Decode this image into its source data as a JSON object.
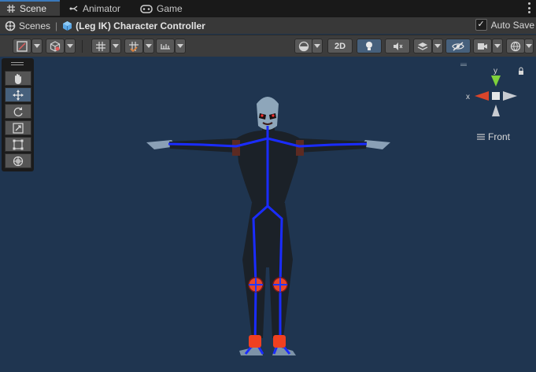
{
  "tabs": [
    {
      "label": "Scene",
      "icon": "grid-icon",
      "active": true
    },
    {
      "label": "Animator",
      "icon": "animator-icon",
      "active": false
    },
    {
      "label": "Game",
      "icon": "gamepad-icon",
      "active": false
    }
  ],
  "breadcrumb": {
    "root": "Scenes",
    "current": "(Leg IK) Character Controller"
  },
  "autosave": {
    "label": "Auto Save",
    "checked": true
  },
  "toolbar": {
    "mode_2d_label": "2D"
  },
  "tools": [
    "hand-tool",
    "move-tool",
    "rotate-tool",
    "scale-tool",
    "rect-tool",
    "transform-tool"
  ],
  "active_tool": "move-tool",
  "gizmo": {
    "y_label": "y",
    "x_label": "x",
    "view_label": "Front"
  },
  "colors": {
    "viewport_bg": "#1f3550",
    "accent": "#3a79bb",
    "bone": "#1a2cff",
    "joint": "#e8452a"
  }
}
